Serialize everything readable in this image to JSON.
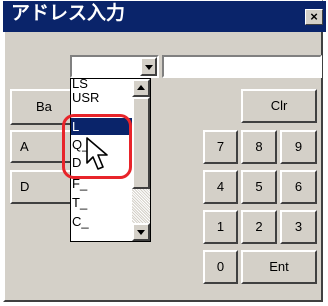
{
  "window": {
    "title": "アドレス入力",
    "close_label": "×"
  },
  "inputs": {
    "device_combo_value": "",
    "address_value": ""
  },
  "left_buttons": {
    "ba_label": "Ba",
    "a_label": "A",
    "d_label": "D"
  },
  "dropdown": {
    "items": [
      "LS",
      "USR",
      "L",
      "Q_",
      "D",
      "F_",
      "T_",
      "C_"
    ],
    "selected_index": 2
  },
  "keypad": {
    "clr_label": "Clr",
    "keys": [
      "7",
      "8",
      "9",
      "4",
      "5",
      "6",
      "1",
      "2",
      "3",
      "0"
    ],
    "ent_label": "Ent"
  },
  "icons": {
    "cursor": "mouse-pointer-icon",
    "highlight": "red-rounded-highlight"
  },
  "colors": {
    "title_bar": "#0a246a",
    "selection": "#0a246a",
    "highlight": "#e8242a",
    "face": "#d4d0c8"
  }
}
